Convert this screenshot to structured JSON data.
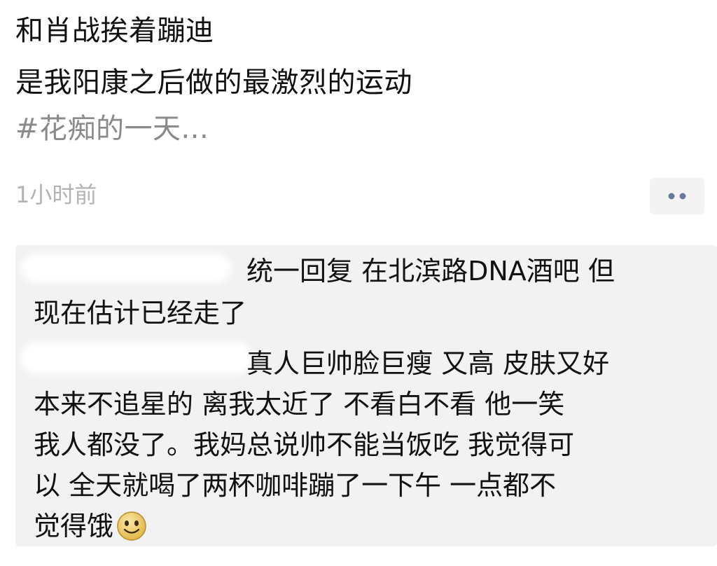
{
  "post": {
    "lines": [
      "和肖战挨着蹦迪",
      "是我阳康之后做的最激烈的运动",
      "#花痴的一天..."
    ],
    "timestamp": "1小时前",
    "more_icon": "more-dots-icon"
  },
  "comments": [
    {
      "lines": [
        "统一回复 在北滨路DNA酒吧 但",
        "现在估计已经走了"
      ]
    },
    {
      "lines": [
        "真人巨帅脸巨瘦 又高 皮肤又好",
        "本来不追星的 离我太近了 不看白不看 他一笑",
        "我人都没了。我妈总说帅不能当饭吃 我觉得可",
        "以 全天就喝了两杯咖啡蹦了一下午 一点都不",
        "觉得饿"
      ],
      "emoji": "smiley-face-icon"
    }
  ],
  "colors": {
    "text_primary": "#111111",
    "hashtag_gray": "#8a8a8a",
    "timestamp_gray": "#b3b3b3",
    "panel_bg": "#f2f2f2",
    "emoji_yellow": "#f5d76e"
  }
}
